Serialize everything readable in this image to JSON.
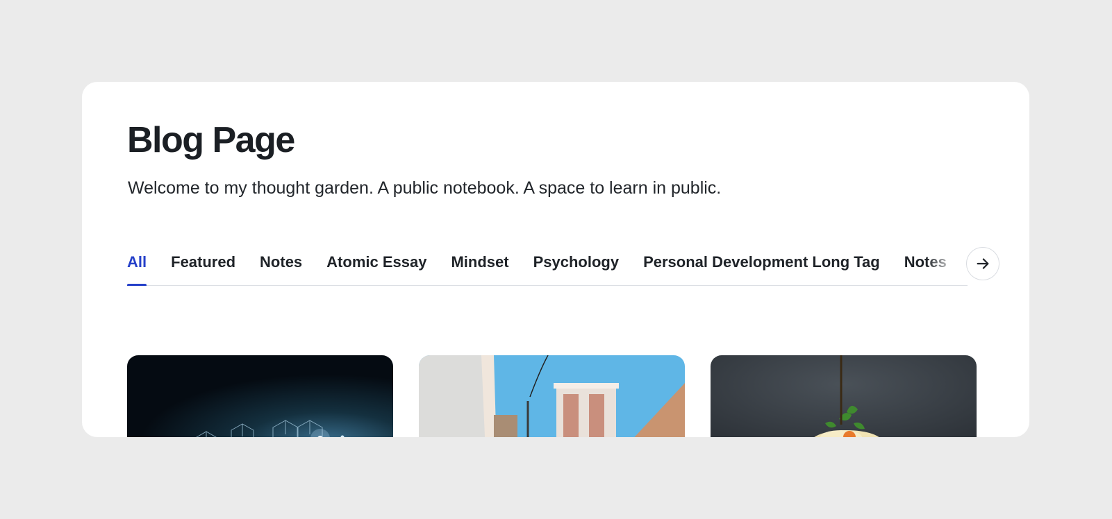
{
  "header": {
    "title": "Blog Page",
    "subtitle": "Welcome to my thought garden. A public notebook. A space to learn in public."
  },
  "tabs": [
    {
      "label": "All",
      "active": true
    },
    {
      "label": "Featured",
      "active": false
    },
    {
      "label": "Notes",
      "active": false
    },
    {
      "label": "Atomic Essay",
      "active": false
    },
    {
      "label": "Mindset",
      "active": false
    },
    {
      "label": "Psychology",
      "active": false
    },
    {
      "label": "Personal Development Long Tag",
      "active": false
    },
    {
      "label": "Notes",
      "active": false
    }
  ],
  "scroll_button": {
    "icon": "arrow-right-icon"
  },
  "posts": [
    {
      "image": "dark-geometric-lights"
    },
    {
      "image": "white-buildings-blue-sky"
    },
    {
      "image": "food-dish-dark-background"
    }
  ],
  "colors": {
    "accent": "#2540c9",
    "page_bg": "#ebebeb",
    "card_bg": "#ffffff",
    "text": "#1b1f24"
  }
}
